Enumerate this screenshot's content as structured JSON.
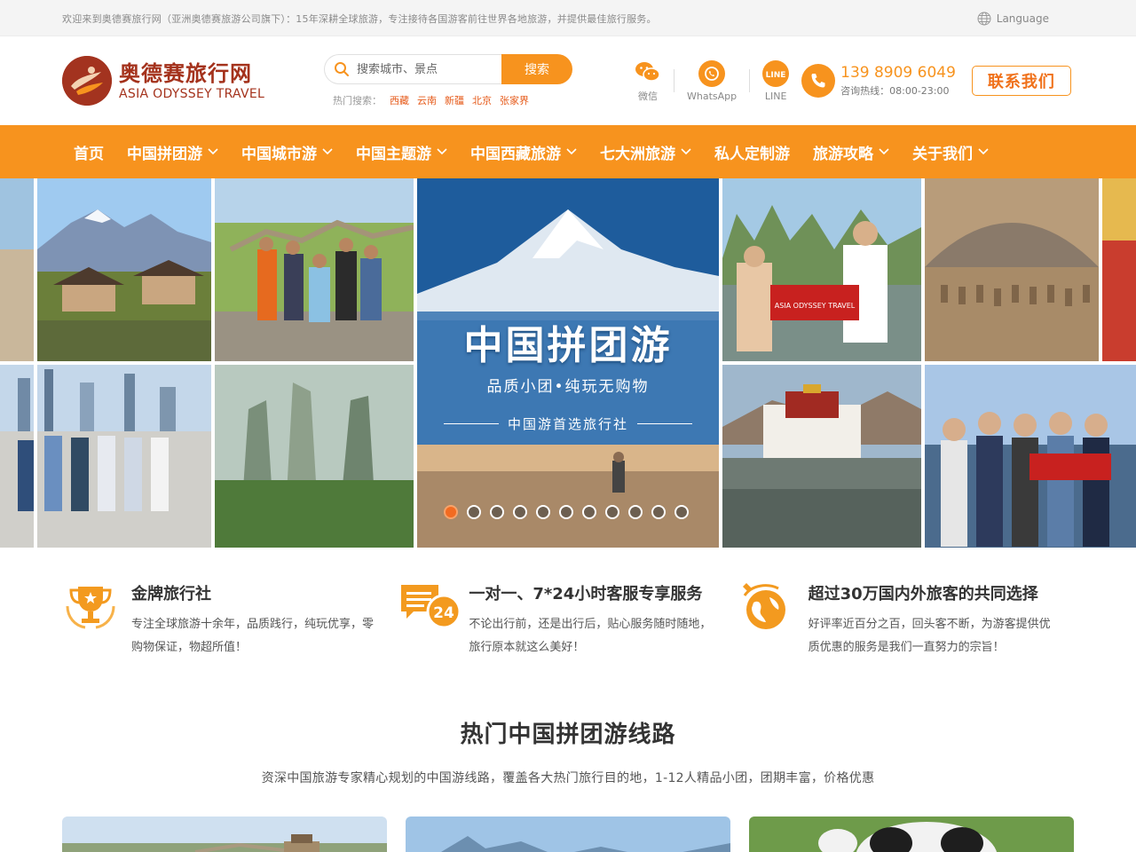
{
  "topbar": {
    "welcome": "欢迎来到奥德赛旅行网（亚洲奥德赛旅游公司旗下）：15年深耕全球旅游，专注接待各国游客前往世界各地旅游，并提供最佳旅行服务。",
    "language": "Language"
  },
  "logo": {
    "cn": "奥德赛旅行网",
    "en": "ASIA ODYSSEY TRAVEL"
  },
  "search": {
    "placeholder": "搜索城市、景点",
    "button": "搜索",
    "hot_label": "热门搜索：",
    "hot_items": [
      "西藏",
      "云南",
      "新疆",
      "北京",
      "张家界"
    ]
  },
  "social": [
    {
      "name": "微信",
      "icon": "wechat-icon"
    },
    {
      "name": "WhatsApp",
      "icon": "whatsapp-icon"
    },
    {
      "name": "LINE",
      "icon": "line-icon"
    }
  ],
  "hotline": {
    "tel": "139 8909 6049",
    "tip": "咨询热线：08:00-23:00"
  },
  "contact_button": "联系我们",
  "nav": [
    {
      "label": "首页",
      "has_menu": false
    },
    {
      "label": "中国拼团游",
      "has_menu": true
    },
    {
      "label": "中国城市游",
      "has_menu": true
    },
    {
      "label": "中国主题游",
      "has_menu": true
    },
    {
      "label": "中国西藏旅游",
      "has_menu": true
    },
    {
      "label": "七大洲旅游",
      "has_menu": true
    },
    {
      "label": "私人定制游",
      "has_menu": false
    },
    {
      "label": "旅游攻略",
      "has_menu": true
    },
    {
      "label": "关于我们",
      "has_menu": true
    }
  ],
  "banner": {
    "title": "中国拼团游",
    "subtitle": "品质小团•纯玩无购物",
    "tagline": "中国游首选旅行社",
    "slide_count": 11,
    "active_slide": 0,
    "flag_text": "ASIA ODYSSEY TRAVEL"
  },
  "features": [
    {
      "icon": "trophy-icon",
      "title": "金牌旅行社",
      "text": "专注全球旅游十余年，品质践行，纯玩优享，零购物保证，物超所值！"
    },
    {
      "icon": "chat-24-icon",
      "title": "一对一、7*24小时客服专享服务",
      "text": "不论出行前，还是出行后，贴心服务随时随地，旅行原本就这么美好！"
    },
    {
      "icon": "globe-plane-icon",
      "title": "超过30万国内外旅客的共同选择",
      "text": "好评率近百分之百，回头客不断，为游客提供优质优惠的服务是我们一直努力的宗旨！"
    }
  ],
  "hot_section": {
    "title": "热门中国拼团游线路",
    "desc": "资深中国旅游专家精心规划的中国游线路，覆盖各大热门旅行目的地，1-12人精品小团，团期丰富，价格优惠"
  },
  "colors": {
    "brand": "#f7931e",
    "logo": "#a4321c",
    "hot_link": "#e65b1b"
  }
}
